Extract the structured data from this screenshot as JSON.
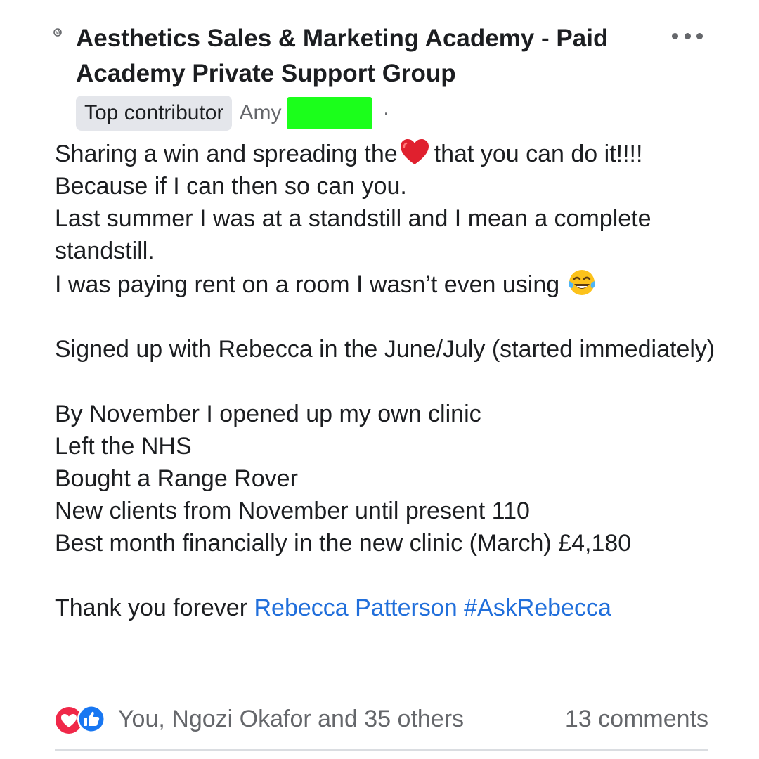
{
  "post": {
    "group_title": "Aesthetics Sales & Marketing Academy - Paid Academy Private Support Group",
    "badge": "Top contributor",
    "author": "Amy",
    "separator": "·",
    "body": {
      "line1_a": "Sharing a win and spreading the",
      "line1_b": "that you can do it!!!! Because if I can then so can you.",
      "line2": "Last summer I was at a standstill and I mean a complete standstill.",
      "line3": "I was paying rent on a room I wasn’t even using",
      "line4": "Signed up with Rebecca in the June/July (started immediately)",
      "line5": "By November I opened up my own clinic",
      "line6": "Left the NHS",
      "line7": "Bought a Range Rover",
      "line8": "New clients from November until present 110",
      "line9": "Best month financially in the new clinic (March) £4,180",
      "thanks_prefix": "Thank you forever",
      "mention": "Rebecca Patterson",
      "hashtag": "#AskRebecca"
    },
    "reactions_text": "You, Ngozi Okafor and 35 others",
    "comments_text": "13 comments"
  },
  "icons": {
    "privacy": "globe-icon",
    "more": "more-options-icon",
    "heart": "red-heart-emoji",
    "laugh": "tears-of-joy-emoji",
    "love_reaction": "love-reaction-icon",
    "like_reaction": "like-reaction-icon"
  },
  "colors": {
    "link": "#216fdb",
    "secondary_text": "#65676b",
    "badge_bg": "#e4e6eb",
    "redaction": "#1bff1b",
    "love": "#f02849",
    "like": "#1877f2"
  }
}
